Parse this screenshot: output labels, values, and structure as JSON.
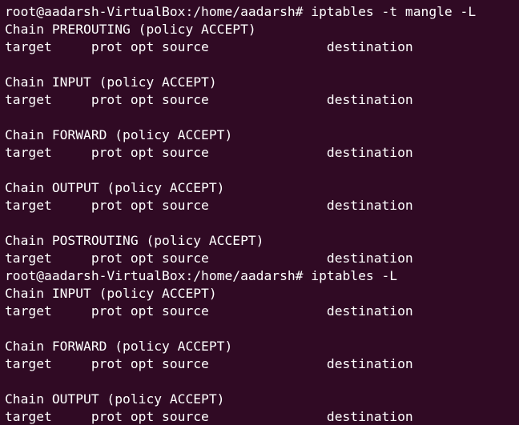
{
  "terminal": {
    "lines": [
      "root@aadarsh-VirtualBox:/home/aadarsh# iptables -t mangle -L",
      "Chain PREROUTING (policy ACCEPT)",
      "target     prot opt source               destination",
      "",
      "Chain INPUT (policy ACCEPT)",
      "target     prot opt source               destination",
      "",
      "Chain FORWARD (policy ACCEPT)",
      "target     prot opt source               destination",
      "",
      "Chain OUTPUT (policy ACCEPT)",
      "target     prot opt source               destination",
      "",
      "Chain POSTROUTING (policy ACCEPT)",
      "target     prot opt source               destination",
      "root@aadarsh-VirtualBox:/home/aadarsh# iptables -L",
      "Chain INPUT (policy ACCEPT)",
      "target     prot opt source               destination",
      "",
      "Chain FORWARD (policy ACCEPT)",
      "target     prot opt source               destination",
      "",
      "Chain OUTPUT (policy ACCEPT)",
      "target     prot opt source               destination"
    ]
  },
  "colors": {
    "background": "#300a24",
    "foreground": "#ffffff"
  }
}
